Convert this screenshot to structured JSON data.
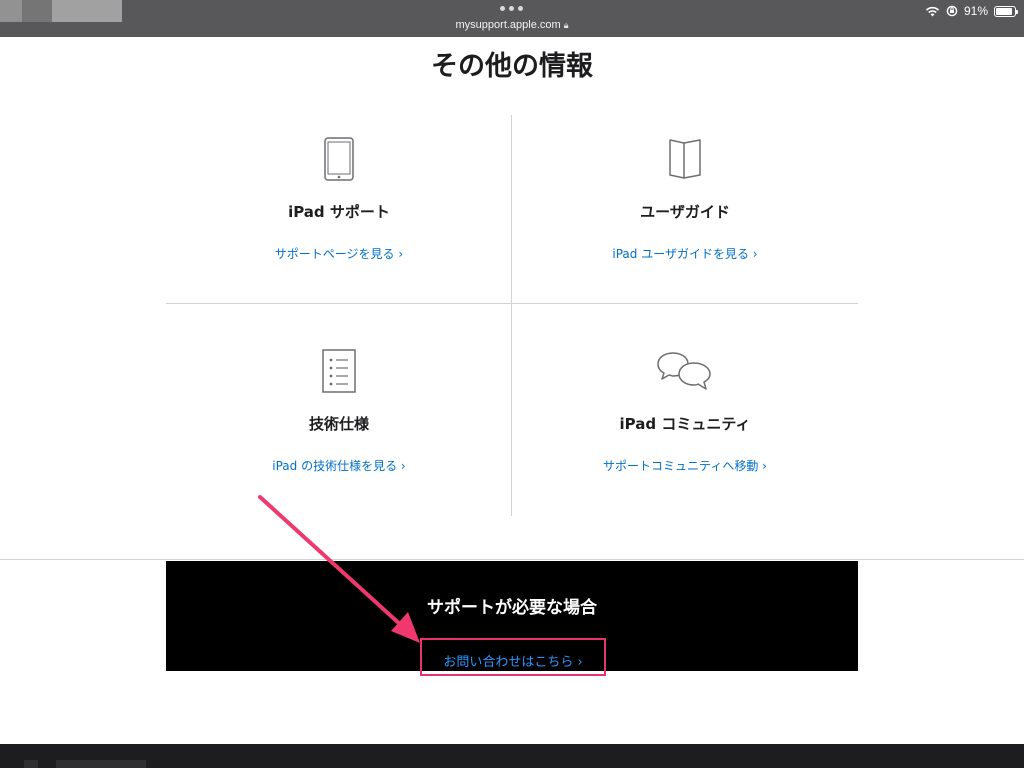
{
  "browser": {
    "url": "mysupport.apple.com",
    "battery_text": "91%",
    "battery_level": 0.91
  },
  "page": {
    "heading": "その他の情報"
  },
  "cards": [
    {
      "icon": "ipad-icon",
      "title": "iPad サポート",
      "link": "サポートページを見る"
    },
    {
      "icon": "book-icon",
      "title": "ユーザガイド",
      "link": "iPad ユーザガイドを見る"
    },
    {
      "icon": "spec-list-icon",
      "title": "技術仕様",
      "link": "iPad の技術仕様を見る"
    },
    {
      "icon": "chat-bubbles-icon",
      "title": "iPad コミュニティ",
      "link": "サポートコミュニティへ移動"
    }
  ],
  "support_banner": {
    "title": "サポートが必要な場合",
    "link": "お問い合わせはこちら"
  },
  "annotation": {
    "highlight_color": "#e8336e",
    "arrow_color": "#f0386f"
  },
  "colors": {
    "link": "#0070c9",
    "banner_link": "#2997ff",
    "banner_bg": "#000000"
  }
}
